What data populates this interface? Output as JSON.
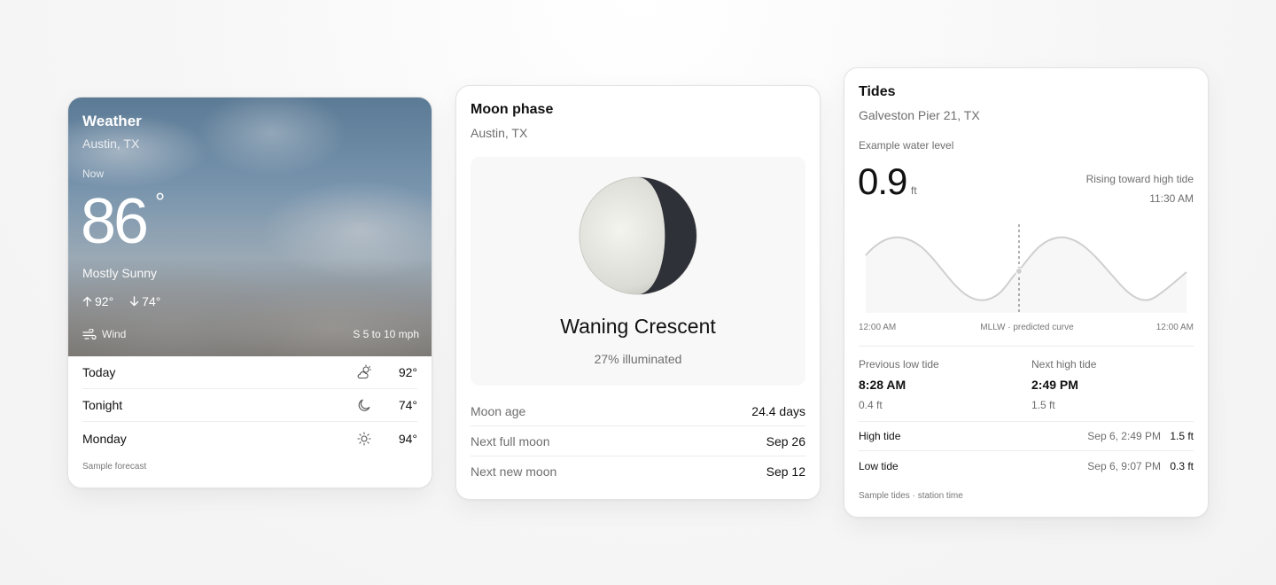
{
  "weather": {
    "title": "Weather",
    "location": "Austin, TX",
    "now_label": "Now",
    "temperature": "86",
    "degree_symbol": "°",
    "condition": "Mostly Sunny",
    "high": "92°",
    "low": "74°",
    "wind_label": "Wind",
    "wind_value": "S 5 to 10 mph",
    "forecast": [
      {
        "day": "Today",
        "icon": "partly-cloudy-icon",
        "temp": "92°"
      },
      {
        "day": "Tonight",
        "icon": "moon-icon",
        "temp": "74°"
      },
      {
        "day": "Monday",
        "icon": "sun-icon",
        "temp": "94°"
      }
    ],
    "footnote": "Sample forecast"
  },
  "moon": {
    "title": "Moon phase",
    "location": "Austin, TX",
    "phase_name": "Waning Crescent",
    "illumination": "27% illuminated",
    "illuminated_fraction": 0.27,
    "rows": [
      {
        "label": "Moon age",
        "value": "24.4 days"
      },
      {
        "label": "Next full moon",
        "value": "Sep 26"
      },
      {
        "label": "Next new moon",
        "value": "Sep 12"
      }
    ]
  },
  "tides": {
    "title": "Tides",
    "location": "Galveston Pier 21, TX",
    "subtitle": "Example water level",
    "level": "0.9",
    "unit": "ft",
    "status": "Rising toward high tide",
    "status_time": "11:30 AM",
    "axis_start": "12:00 AM",
    "axis_middle": "MLLW · predicted curve",
    "axis_end": "12:00 AM",
    "previous": {
      "label": "Previous low tide",
      "time": "8:28 AM",
      "height": "0.4 ft"
    },
    "next": {
      "label": "Next high tide",
      "time": "2:49 PM",
      "height": "1.5 ft"
    },
    "events": [
      {
        "name": "High tide",
        "when": "Sep 6, 2:49 PM",
        "height": "1.5 ft"
      },
      {
        "name": "Low tide",
        "when": "Sep 6, 9:07 PM",
        "height": "0.3 ft"
      }
    ],
    "footnote": "Sample tides · station time"
  }
}
